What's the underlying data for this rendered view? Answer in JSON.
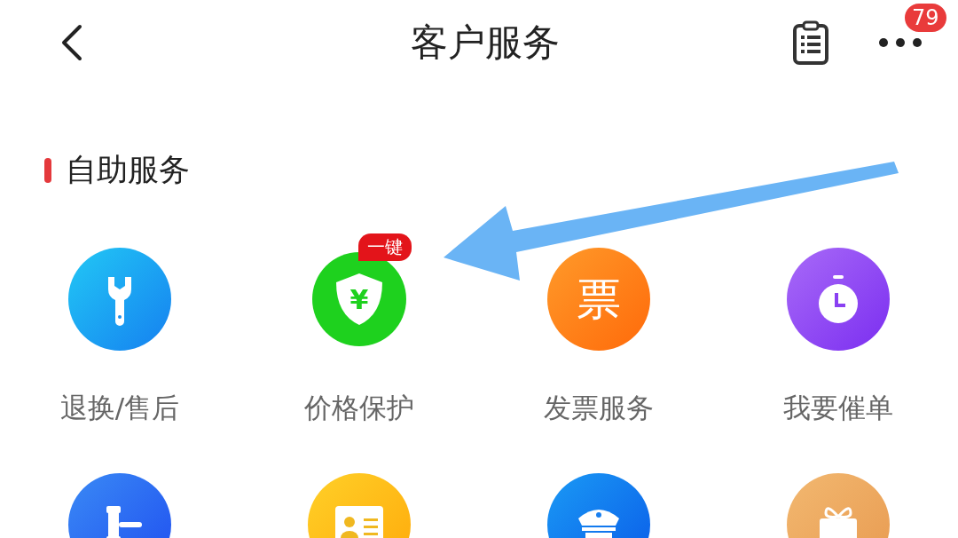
{
  "header": {
    "title": "客户服务",
    "more_badge": "79"
  },
  "section": {
    "title": "自助服务"
  },
  "services": [
    {
      "kind": "wrench",
      "label": "退换/售后"
    },
    {
      "kind": "shield",
      "symbol": "¥",
      "label": "价格保护",
      "badge": "一键"
    },
    {
      "kind": "glyph",
      "symbol": "票",
      "label": "发票服务"
    },
    {
      "kind": "stopwatch",
      "label": "我要催单"
    },
    {
      "kind": "gavel"
    },
    {
      "kind": "idcard"
    },
    {
      "kind": "cap"
    },
    {
      "kind": "gift"
    }
  ]
}
